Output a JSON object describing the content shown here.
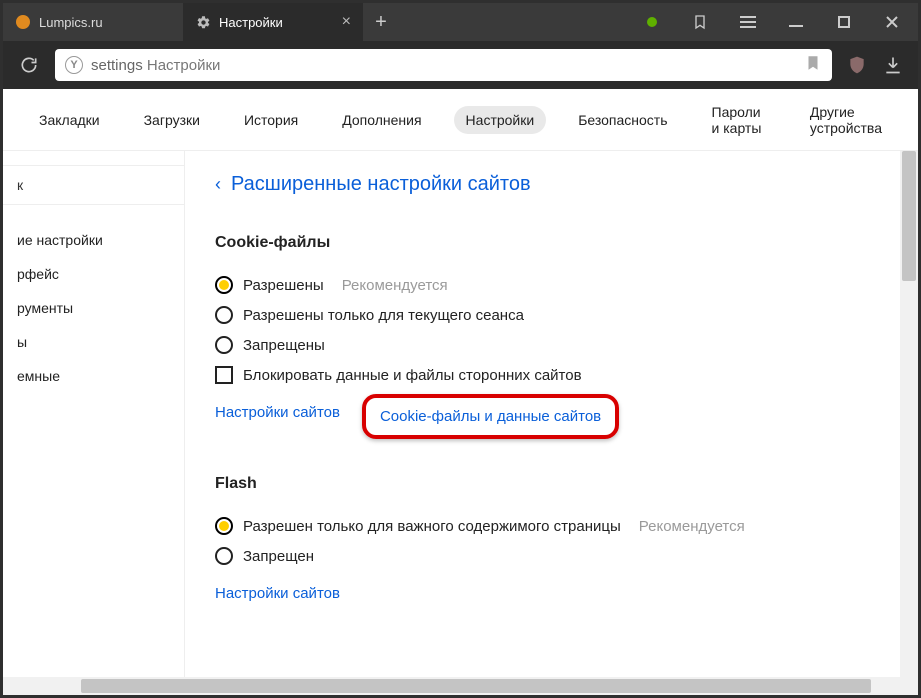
{
  "tabs": [
    {
      "title": "Lumpics.ru",
      "active": false
    },
    {
      "title": "Настройки",
      "active": true
    }
  ],
  "address": {
    "scope": "settings",
    "title": "Настройки"
  },
  "topnav": {
    "items": [
      {
        "label": "Закладки"
      },
      {
        "label": "Загрузки"
      },
      {
        "label": "История"
      },
      {
        "label": "Дополнения"
      },
      {
        "label": "Настройки",
        "active": true
      },
      {
        "label": "Безопасность"
      },
      {
        "label": "Пароли и карты"
      },
      {
        "label": "Другие устройства"
      }
    ]
  },
  "sidebar": {
    "search_value": "к",
    "items": [
      {
        "label": "ие настройки"
      },
      {
        "label": "рфейс"
      },
      {
        "label": "рументы"
      },
      {
        "label": "ы"
      },
      {
        "label": "емные"
      }
    ]
  },
  "page": {
    "back_title": "Расширенные настройки сайтов",
    "cookies": {
      "title": "Cookie-файлы",
      "options": [
        {
          "label": "Разрешены",
          "hint": "Рекомендуется",
          "checked": true
        },
        {
          "label": "Разрешены только для текущего сеанса",
          "checked": false
        },
        {
          "label": "Запрещены",
          "checked": false
        }
      ],
      "checkbox_label": "Блокировать данные и файлы сторонних сайтов",
      "links": {
        "site_settings": "Настройки сайтов",
        "cookies_data": "Cookie-файлы и данные сайтов"
      }
    },
    "flash": {
      "title": "Flash",
      "options": [
        {
          "label": "Разрешен только для важного содержимого страницы",
          "hint": "Рекомендуется",
          "checked": true
        },
        {
          "label": "Запрещен",
          "checked": false
        }
      ],
      "links": {
        "site_settings": "Настройки сайтов"
      }
    }
  }
}
